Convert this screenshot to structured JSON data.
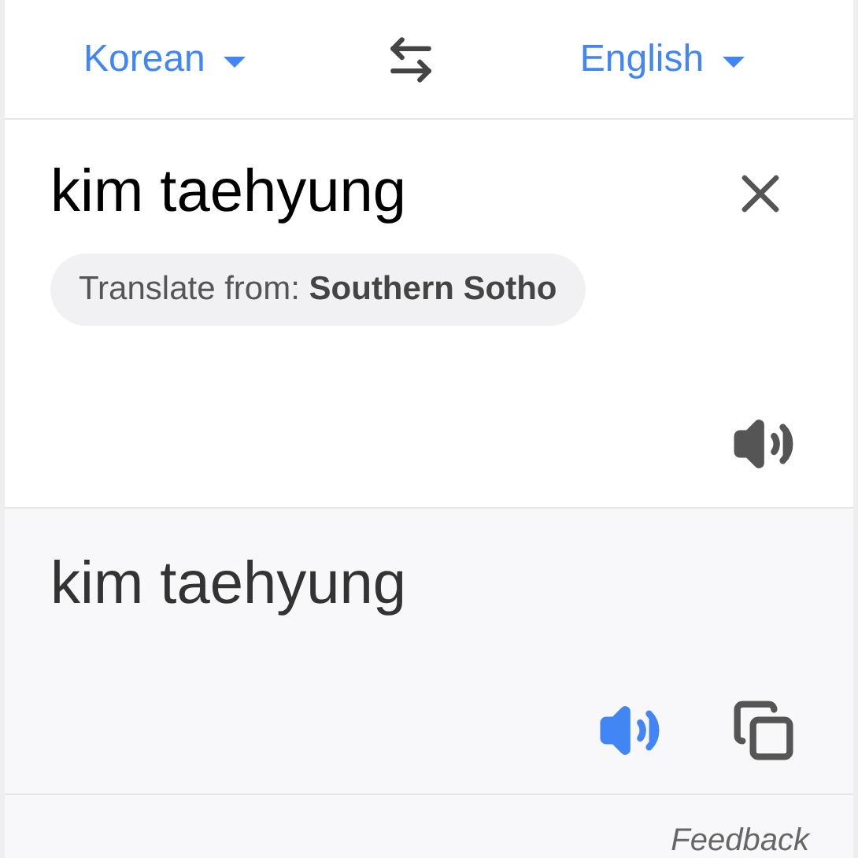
{
  "source_language": {
    "label": "Korean"
  },
  "target_language": {
    "label": "English"
  },
  "input": {
    "value": "kim taehyung"
  },
  "suggestion": {
    "prefix": "Translate from:",
    "language": "Southern Sotho"
  },
  "output": {
    "text": "kim taehyung"
  },
  "feedback": "Feedback"
}
